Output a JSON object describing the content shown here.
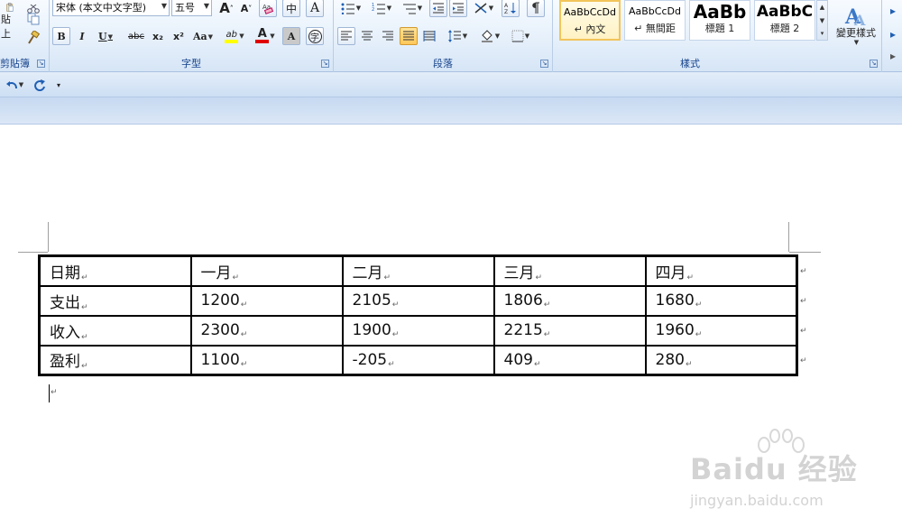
{
  "clipboard": {
    "paste_label": "貼上",
    "group_label": "剪貼簿"
  },
  "font": {
    "family_value": "宋体 (本文中文字型)",
    "size_value": "五号",
    "grow_label": "A",
    "shrink_label": "A",
    "phonetic_label": "中",
    "char_border_label": "A",
    "bold_label": "B",
    "italic_label": "I",
    "underline_label": "U",
    "strike_label": "abc",
    "subscript_label": "x₂",
    "superscript_label": "x²",
    "case_label": "Aa",
    "highlight_label": "ab",
    "color_label": "A",
    "shading_label": "A",
    "enclose_label": "字",
    "group_label": "字型",
    "highlight_color": "#ffff00",
    "font_color": "#e00000"
  },
  "paragraph": {
    "group_label": "段落"
  },
  "styles": {
    "items": [
      {
        "sample": "AaBbCcDd",
        "name": "↵ 內文"
      },
      {
        "sample": "AaBbCcDd",
        "name": "↵ 無間距"
      },
      {
        "sample": "AaBb",
        "name": "標題 1"
      },
      {
        "sample": "AaBbC",
        "name": "標題 2"
      }
    ],
    "change_styles_label": "變更樣式",
    "group_label": "樣式"
  },
  "qat": {
    "undo_icon": "undo-icon",
    "redo_icon": "redo-icon",
    "customize_icon": "customize-icon"
  },
  "table": {
    "rows": [
      [
        "日期",
        "一月",
        "二月",
        "三月",
        "四月"
      ],
      [
        "支出",
        "1200",
        "2105",
        "1806",
        "1680"
      ],
      [
        "收入",
        "2300",
        "1900",
        "2215",
        "1960"
      ],
      [
        "盈利",
        "1100",
        "-205",
        "409",
        "280"
      ]
    ],
    "cell_mark": "↵",
    "row_end_mark": "↵"
  },
  "watermark": {
    "logo_text": "Baidu 经验",
    "url": "jingyan.baidu.com"
  },
  "colors": {
    "ribbon_label": "#15428b",
    "accent": "#1f5fb4"
  }
}
